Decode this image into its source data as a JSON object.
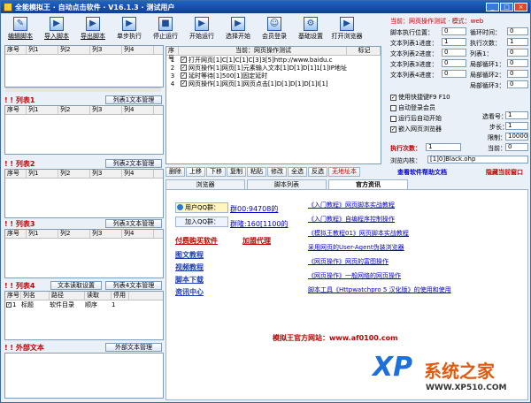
{
  "window": {
    "title": "全能模拟王 · 自动点击软件 · V16.1.3 · 测试用户",
    "min": "_",
    "max": "□",
    "close": "×"
  },
  "toolbar": [
    {
      "label": "编辑脚本",
      "icon": "edit-script-icon"
    },
    {
      "label": "导入脚本",
      "icon": "import-icon"
    },
    {
      "label": "导出脚本",
      "icon": "export-icon"
    },
    {
      "label": "单步执行",
      "icon": "step-icon"
    },
    {
      "label": "停止运行",
      "icon": "stop-icon"
    },
    {
      "label": "开始运行",
      "icon": "play-icon"
    },
    {
      "label": "选择开始",
      "icon": "select-start-icon"
    },
    {
      "label": "会员登录",
      "icon": "user-login-icon"
    },
    {
      "label": "基础设置",
      "icon": "settings-icon"
    },
    {
      "label": "打开浏览器",
      "icon": "browser-icon"
    }
  ],
  "left": {
    "top_grid_cols": [
      "序号",
      "列1",
      "列2",
      "列3",
      "列4"
    ],
    "sections": [
      {
        "name": "! ! 列表1",
        "button": "列表1文本管理"
      },
      {
        "name": "! ! 列表2",
        "button": "列表2文本管理"
      },
      {
        "name": "! ! 列表3",
        "button": "列表3文本管理"
      },
      {
        "name": "! ! 列表4",
        "button": "列表4文本管理",
        "extra_button": "文本读取设置"
      },
      {
        "name": "! ! 外部文本",
        "button": "外部文本管理"
      }
    ],
    "list_cols": [
      "序号",
      "列1",
      "列2",
      "列3",
      "列4"
    ],
    "list4_cols": [
      "序号",
      "列名",
      "路径",
      "读取",
      "停用"
    ],
    "list4_row": {
      "n": "1",
      "name": "标题",
      "path": "软件目录",
      "read": "顺序",
      "stop": "1"
    }
  },
  "script": {
    "cols": [
      "序号",
      "当前：网页操作测试",
      "标记"
    ],
    "rows": [
      {
        "n": "1",
        "text": "打开网页[1]C[1]C[1]C[3]3[5]http://www.baidu.c"
      },
      {
        "n": "2",
        "text": "网页操作[1]网页[1]元素输入文本[1]D[1]D[1]1[1]IP地址"
      },
      {
        "n": "3",
        "text": "延时等待[1]500[1]固定延时"
      },
      {
        "n": "4",
        "text": "网页操作[1]网页[1]网页点击[1]D[1]D[1]D[1]I[1]"
      }
    ]
  },
  "script_toolbar": [
    "删除",
    "上移",
    "下移",
    "复制",
    "粘贴",
    "修改",
    "全选",
    "反选",
    "无地址本"
  ],
  "right": {
    "title": "当前：网页操作测试 · 模式：web",
    "fields": [
      {
        "l1": "脚本执行位置：",
        "v1": "0",
        "l2": "循环时间：",
        "v2": "0"
      },
      {
        "l1": "文本列表1进度：",
        "v1": "1",
        "l2": "执行次数：",
        "v2": "1"
      },
      {
        "l1": "文本列表2进度：",
        "v1": "0",
        "l2": "列表1：",
        "v2": "0"
      },
      {
        "l1": "文本列表3进度：",
        "v1": "0",
        "l2": "局部循环1：",
        "v2": "0"
      },
      {
        "l1": "文本列表4进度：",
        "v1": "0",
        "l2": "局部循环2：",
        "v2": "0"
      },
      {
        "l1": "",
        "v1": "",
        "l2": "局部循环3：",
        "v2": "0"
      }
    ],
    "checks": [
      {
        "label": "使用快捷键F9 F10",
        "checked": true
      },
      {
        "label": "自动登录会员",
        "checked": false
      },
      {
        "label": "运行后自动开始",
        "checked": false
      },
      {
        "label": "嵌入网页浏览器",
        "checked": true
      }
    ],
    "sel_label": "选看号：",
    "sel_val": "1",
    "step_label": "步长：",
    "step_val": "1",
    "limit_label": "限制：",
    "limit_val": "10000",
    "exec_label": "执行次数：",
    "exec_val": "1",
    "cur_label": "当前：",
    "cur_val": "0",
    "browser_label": "浏览内核：",
    "browser_val": "[1]0]Black.ohp"
  },
  "help": {
    "doc": "查看软件帮助文档",
    "hide": "隐藏当前窗口"
  },
  "tabs": [
    "浏览器",
    "脚本列表",
    "官方资讯"
  ],
  "panel": {
    "qq1_label": "用户QQ群：",
    "qq1": "群00:94708的",
    "qq2_label": "加入QQ群：",
    "qq2": "群隆:160[1100的",
    "buy": "付费购买软件",
    "agent": "加盟代理",
    "links_left": [
      "图文教程",
      "视频教程",
      "脚本下载",
      "资讯中心"
    ],
    "links_right": [
      "《入门教程》网页脚本实战教程",
      "《入门教程》自编程序控制操作",
      "《模拟王教程01》网页脚本实战教程",
      "采用网页的User-Agent伪装浏览器",
      "《网页操作》网页的富图操作",
      "《网页操作》一般网络的网页操作",
      "脚本工具《Httpwatchpro 5 汉化版》的使用和使用"
    ],
    "site": "模拟王官方网站：www.af0100.com"
  },
  "watermark": {
    "brand": "系统之家",
    "url": "WWW.XP510.COM",
    "logo": "XP"
  },
  "colors": {
    "accent": "#1f63c4",
    "red": "#c00000",
    "blue_link": "#0000cc"
  }
}
